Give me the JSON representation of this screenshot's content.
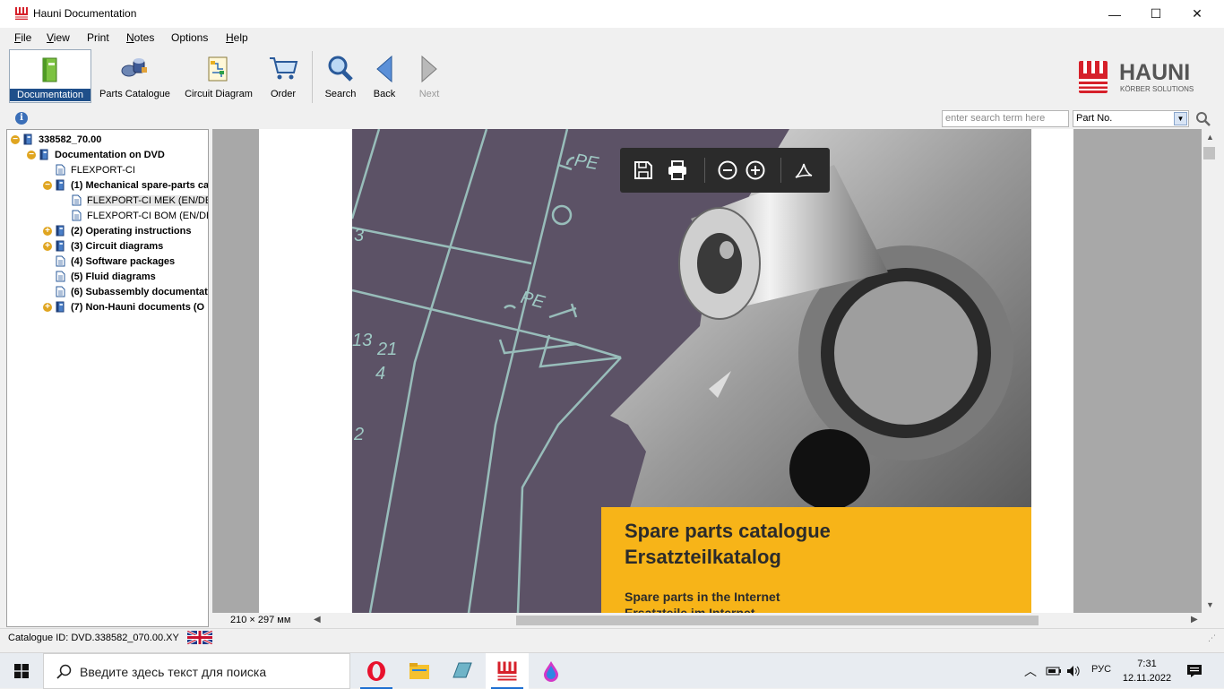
{
  "window": {
    "title": "Hauni Documentation",
    "controls": {
      "minimize": "—",
      "maximize": "☐",
      "close": "✕"
    }
  },
  "menu": [
    {
      "key": "F",
      "rest": "ile"
    },
    {
      "key": "V",
      "rest": "iew"
    },
    {
      "key": "",
      "rest": "Print",
      "under": "t"
    },
    {
      "key": "N",
      "rest": "otes"
    },
    {
      "key": "",
      "rest": "Options",
      "under": "O"
    },
    {
      "key": "H",
      "rest": "elp"
    }
  ],
  "toolbar": {
    "documentation": "Documentation",
    "parts_catalogue": "Parts Catalogue",
    "circuit_diagram": "Circuit Diagram",
    "order": "Order",
    "search": "Search",
    "back": "Back",
    "next": "Next"
  },
  "logo": {
    "name": "HAUNI",
    "sub": "KÖRBER SOLUTIONS",
    "color": "#d6202a"
  },
  "searchbar": {
    "placeholder": "enter search term here",
    "field_selected": "Part No."
  },
  "tree": [
    {
      "label": "338582_70.00",
      "bold": true,
      "expander": "minus"
    },
    {
      "label": "Documentation on DVD",
      "bold": true,
      "expander": "minus"
    },
    {
      "label": "FLEXPORT-CI",
      "bold": false,
      "expander": ""
    },
    {
      "label": "(1) Mechanical spare-parts ca",
      "bold": true,
      "expander": "minus"
    },
    {
      "label": "FLEXPORT-CI MEK (EN/DE)",
      "bold": false,
      "expander": "",
      "selected": true
    },
    {
      "label": "FLEXPORT-CI BOM (EN/DE)",
      "bold": false,
      "expander": ""
    },
    {
      "label": "(2) Operating instructions",
      "bold": true,
      "expander": "plus"
    },
    {
      "label": "(3) Circuit diagrams",
      "bold": true,
      "expander": "plus"
    },
    {
      "label": "(4) Software packages",
      "bold": true,
      "expander": ""
    },
    {
      "label": "(5) Fluid diagrams",
      "bold": true,
      "expander": ""
    },
    {
      "label": "(6) Subassembly documentat",
      "bold": true,
      "expander": ""
    },
    {
      "label": "(7) Non-Hauni documents (O",
      "bold": true,
      "expander": "plus"
    }
  ],
  "document": {
    "title_en": "Spare parts catalogue",
    "title_de": "Ersatzteilkatalog",
    "sub_en": "Spare parts in the Internet",
    "sub_de": "Ersatzteile im Internet",
    "drawing_labels": [
      "PE",
      "PE",
      "3",
      "13",
      "21",
      "4",
      "2"
    ],
    "page_size": "210 × 297 мм"
  },
  "status": {
    "catalogue_id": "Catalogue ID: DVD.338582_070.00.XY"
  },
  "taskbar": {
    "search_placeholder": "Введите здесь текст для поиска",
    "language": "РУС",
    "time": "7:31",
    "date": "12.11.2022"
  }
}
